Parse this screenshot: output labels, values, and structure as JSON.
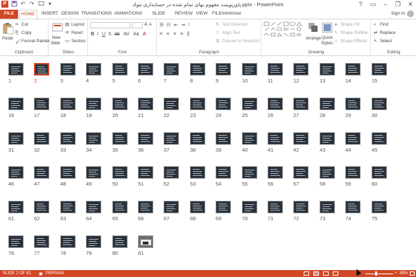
{
  "window": {
    "title": "پاورپوینت مفهوم بهای تمام شده در حسابداری مواد.pptx - PowerPoint",
    "app_logo": "P",
    "quick_access": [
      "save-icon",
      "undo-icon",
      "redo-icon",
      "start-from-beginning-icon",
      "customize-qat-icon"
    ],
    "controls": {
      "help": "?",
      "ribbon_options": "▭",
      "minimize": "–",
      "restore": "❐",
      "close": "✕"
    }
  },
  "tabs": [
    {
      "label": "FILE",
      "name": "tab-file"
    },
    {
      "label": "HOME",
      "name": "tab-home",
      "active": true
    },
    {
      "label": "INSERT",
      "name": "tab-insert"
    },
    {
      "label": "DESIGN",
      "name": "tab-design"
    },
    {
      "label": "TRANSITIONS",
      "name": "tab-transitions"
    },
    {
      "label": "ANIMATIONS",
      "name": "tab-animations"
    },
    {
      "label": "SLIDE SHOW",
      "name": "tab-slide-show"
    },
    {
      "label": "REVIEW",
      "name": "tab-review"
    },
    {
      "label": "VIEW",
      "name": "tab-view"
    },
    {
      "label": "FILEminimizer",
      "name": "tab-fileminimizer"
    }
  ],
  "signin": "Sign in",
  "ribbon": {
    "clipboard": {
      "label": "Clipboard",
      "paste": "Paste",
      "cut": "Cut",
      "copy": "Copy",
      "format_painter": "Format Painter"
    },
    "slides": {
      "label": "Slides",
      "new_slide_1": "New",
      "new_slide_2": "Slide",
      "layout": "Layout",
      "reset": "Reset",
      "section": "Section"
    },
    "font": {
      "label": "Font"
    },
    "paragraph": {
      "label": "Paragraph",
      "text_direction": "Text Direction",
      "align_text": "Align Text",
      "convert_smartart": "Convert to SmartArt"
    },
    "drawing": {
      "label": "Drawing",
      "arrange": "Arrange",
      "quick_styles_1": "Quick",
      "quick_styles_2": "Styles",
      "shape_fill": "Shape Fill",
      "shape_outline": "Shape Outline",
      "shape_effects": "Shape Effects"
    },
    "editing": {
      "label": "Editing",
      "find": "Find",
      "replace": "Replace",
      "select": "Select"
    }
  },
  "slides": {
    "total": 81,
    "selected": 2,
    "per_row": 15,
    "photo_slide": 81
  },
  "status": {
    "slide_indicator": "SLIDE 2 OF 81",
    "language": "PERSIAN",
    "zoom": "39%",
    "zoom_fraction": 0.39
  },
  "colors": {
    "accent": "#d24726",
    "slide_bg": "#28313b"
  }
}
